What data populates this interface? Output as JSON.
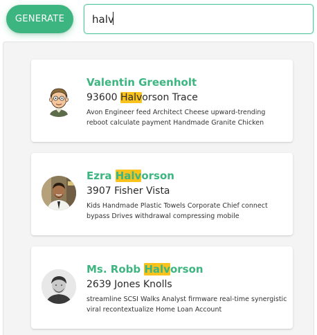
{
  "toolbar": {
    "generate_label": "GENERATE",
    "accent_color": "#3db580"
  },
  "search": {
    "value": "halv",
    "highlight_color": "#f9c21c"
  },
  "results": [
    {
      "name_pre": "Valentin Greenholt",
      "name_hl": "",
      "name_post": "",
      "addr_pre": "93600 ",
      "addr_hl": "Halv",
      "addr_post": "orson Trace",
      "description": "Avon Engineer feed Architect Cheese upward-trending reboot calculate payment Handmade Granite Chicken",
      "avatar_icon": "cartoon-avatar-icon"
    },
    {
      "name_pre": "Ezra ",
      "name_hl": "Halv",
      "name_post": "orson",
      "addr_pre": "3907 Fisher Vista",
      "addr_hl": "",
      "addr_post": "",
      "description": "Kids Handmade Plastic Towels Corporate Chief connect bypass Drives withdrawal compressing mobile",
      "avatar_icon": "photo-avatar-icon"
    },
    {
      "name_pre": "Ms. Robb ",
      "name_hl": "Halv",
      "name_post": "orson",
      "addr_pre": "2639 Jones Knolls",
      "addr_hl": "",
      "addr_post": "",
      "description": "streamline SCSI Walks Analyst firmware real-time synergistic viral recontextualize Home Loan Account",
      "avatar_icon": "photo-avatar-icon"
    }
  ]
}
